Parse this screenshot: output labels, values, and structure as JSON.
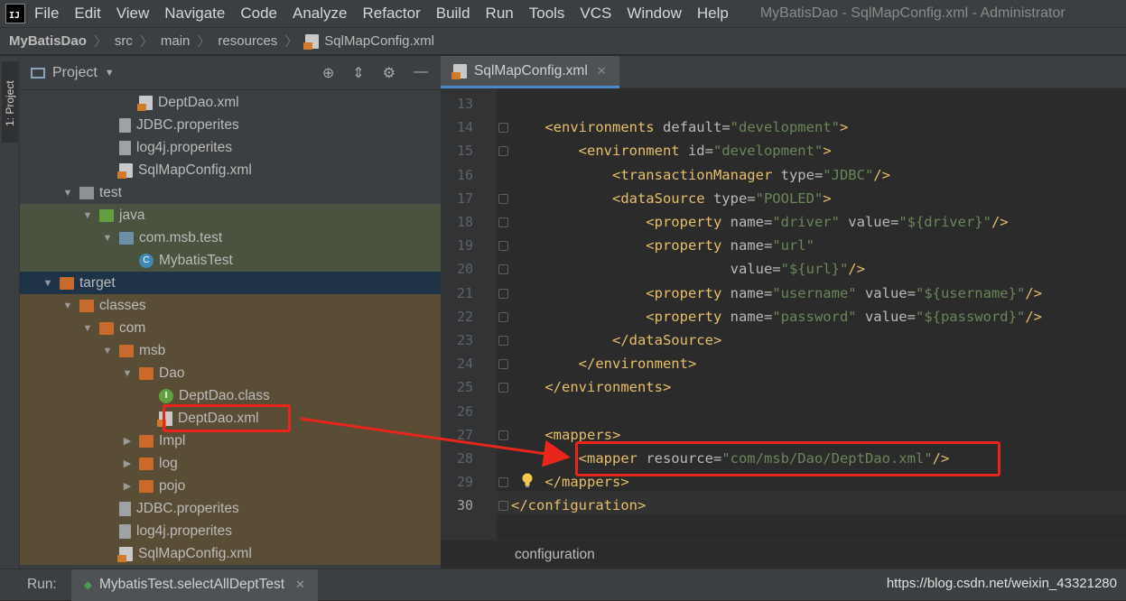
{
  "menubar": {
    "logo": "IJ",
    "items": [
      "File",
      "Edit",
      "View",
      "Navigate",
      "Code",
      "Analyze",
      "Refactor",
      "Build",
      "Run",
      "Tools",
      "VCS",
      "Window",
      "Help"
    ],
    "window_title": "MyBatisDao - SqlMapConfig.xml - Administrator"
  },
  "navbar": {
    "crumbs": [
      "MyBatisDao",
      "src",
      "main",
      "resources",
      "SqlMapConfig.xml"
    ]
  },
  "left_strip": {
    "tab_label": "1: Project"
  },
  "project": {
    "header": "Project",
    "rows": [
      {
        "label": "DeptDao.xml",
        "icon": "xml-file-icon",
        "indent": 4,
        "arrow": "",
        "bg": ""
      },
      {
        "label": "JDBC.properites",
        "icon": "properties-file-icon",
        "indent": 3,
        "arrow": "",
        "bg": ""
      },
      {
        "label": "log4j.properites",
        "icon": "properties-file-icon",
        "indent": 3,
        "arrow": "",
        "bg": ""
      },
      {
        "label": "SqlMapConfig.xml",
        "icon": "xml-file-icon",
        "indent": 3,
        "arrow": "",
        "bg": ""
      },
      {
        "label": "test",
        "icon": "folder-icon",
        "indent": 1,
        "arrow": "down",
        "bg": ""
      },
      {
        "label": "java",
        "icon": "test-source-folder-icon",
        "indent": 2,
        "arrow": "down",
        "bg": "g"
      },
      {
        "label": "com.msb.test",
        "icon": "package-icon",
        "indent": 3,
        "arrow": "down",
        "bg": "g"
      },
      {
        "label": "MybatisTest",
        "icon": "class-icon",
        "indent": 4,
        "arrow": "",
        "bg": "g"
      },
      {
        "label": "target",
        "icon": "excluded-folder-icon",
        "indent": 0,
        "arrow": "down",
        "bg": "b"
      },
      {
        "label": "classes",
        "icon": "excluded-folder-icon",
        "indent": 1,
        "arrow": "down",
        "bg": "o"
      },
      {
        "label": "com",
        "icon": "excluded-folder-icon",
        "indent": 2,
        "arrow": "down",
        "bg": "o"
      },
      {
        "label": "msb",
        "icon": "excluded-folder-icon",
        "indent": 3,
        "arrow": "down",
        "bg": "o"
      },
      {
        "label": "Dao",
        "icon": "excluded-folder-icon",
        "indent": 4,
        "arrow": "down",
        "bg": "o"
      },
      {
        "label": "DeptDao.class",
        "icon": "interface-class-icon",
        "indent": 5,
        "arrow": "",
        "bg": "o"
      },
      {
        "label": "DeptDao.xml",
        "icon": "xml-file-icon",
        "indent": 5,
        "arrow": "",
        "bg": "o"
      },
      {
        "label": "Impl",
        "icon": "excluded-folder-icon",
        "indent": 4,
        "arrow": "right",
        "bg": "o"
      },
      {
        "label": "log",
        "icon": "excluded-folder-icon",
        "indent": 4,
        "arrow": "right",
        "bg": "o"
      },
      {
        "label": "pojo",
        "icon": "excluded-folder-icon",
        "indent": 4,
        "arrow": "right",
        "bg": "o"
      },
      {
        "label": "JDBC.properites",
        "icon": "properties-file-icon",
        "indent": 3,
        "arrow": "",
        "bg": "o"
      },
      {
        "label": "log4j.properites",
        "icon": "properties-file-icon",
        "indent": 3,
        "arrow": "",
        "bg": "o"
      },
      {
        "label": "SqlMapConfig.xml",
        "icon": "xml-file-icon",
        "indent": 3,
        "arrow": "",
        "bg": "o"
      }
    ]
  },
  "editor": {
    "tab": "SqlMapConfig.xml",
    "current_line": 30,
    "lines": [
      {
        "n": 13,
        "tokens": []
      },
      {
        "n": 14,
        "tokens": [
          [
            "tag",
            "    <environments "
          ],
          [
            "att",
            "default"
          ],
          [
            "ep",
            "="
          ],
          [
            "val",
            "\"development\""
          ],
          [
            "tag",
            ">"
          ]
        ]
      },
      {
        "n": 15,
        "tokens": [
          [
            "tag",
            "        <environment "
          ],
          [
            "att",
            "id"
          ],
          [
            "ep",
            "="
          ],
          [
            "val",
            "\"development\""
          ],
          [
            "tag",
            ">"
          ]
        ]
      },
      {
        "n": 16,
        "tokens": [
          [
            "tag",
            "            <transactionManager "
          ],
          [
            "att",
            "type"
          ],
          [
            "ep",
            "="
          ],
          [
            "val",
            "\"JDBC\""
          ],
          [
            "tag",
            "/>"
          ]
        ]
      },
      {
        "n": 17,
        "tokens": [
          [
            "tag",
            "            <dataSource "
          ],
          [
            "att",
            "type"
          ],
          [
            "ep",
            "="
          ],
          [
            "val",
            "\"POOLED\""
          ],
          [
            "tag",
            ">"
          ]
        ]
      },
      {
        "n": 18,
        "tokens": [
          [
            "tag",
            "                <property "
          ],
          [
            "att",
            "name"
          ],
          [
            "ep",
            "="
          ],
          [
            "val",
            "\"driver\""
          ],
          [
            "att",
            " value"
          ],
          [
            "ep",
            "="
          ],
          [
            "val",
            "\"${driver}\""
          ],
          [
            "tag",
            "/>"
          ]
        ]
      },
      {
        "n": 19,
        "tokens": [
          [
            "tag",
            "                <property "
          ],
          [
            "att",
            "name"
          ],
          [
            "ep",
            "="
          ],
          [
            "val",
            "\"url\""
          ]
        ]
      },
      {
        "n": 20,
        "tokens": [
          [
            "att",
            "                          value"
          ],
          [
            "ep",
            "="
          ],
          [
            "val",
            "\"${url}\""
          ],
          [
            "tag",
            "/>"
          ]
        ]
      },
      {
        "n": 21,
        "tokens": [
          [
            "tag",
            "                <property "
          ],
          [
            "att",
            "name"
          ],
          [
            "ep",
            "="
          ],
          [
            "val",
            "\"username\""
          ],
          [
            "att",
            " value"
          ],
          [
            "ep",
            "="
          ],
          [
            "val",
            "\"${username}\""
          ],
          [
            "tag",
            "/>"
          ]
        ]
      },
      {
        "n": 22,
        "tokens": [
          [
            "tag",
            "                <property "
          ],
          [
            "att",
            "name"
          ],
          [
            "ep",
            "="
          ],
          [
            "val",
            "\"password\""
          ],
          [
            "att",
            " value"
          ],
          [
            "ep",
            "="
          ],
          [
            "val",
            "\"${password}\""
          ],
          [
            "tag",
            "/>"
          ]
        ]
      },
      {
        "n": 23,
        "tokens": [
          [
            "tag",
            "            </dataSource>"
          ]
        ]
      },
      {
        "n": 24,
        "tokens": [
          [
            "tag",
            "        </environment>"
          ]
        ]
      },
      {
        "n": 25,
        "tokens": [
          [
            "tag",
            "    </environments>"
          ]
        ]
      },
      {
        "n": 26,
        "tokens": []
      },
      {
        "n": 27,
        "tokens": [
          [
            "tag",
            "    <mappers>"
          ]
        ]
      },
      {
        "n": 28,
        "tokens": [
          [
            "tag",
            "        <mapper "
          ],
          [
            "att",
            "resource"
          ],
          [
            "ep",
            "="
          ],
          [
            "val",
            "\"com/msb/Dao/DeptDao.xml\""
          ],
          [
            "tag",
            "/>"
          ]
        ]
      },
      {
        "n": 29,
        "tokens": [
          [
            "tag",
            "    </mappers>"
          ]
        ]
      },
      {
        "n": 30,
        "tokens": [
          [
            "tag",
            "</configuration>"
          ]
        ]
      }
    ],
    "breadcrumb": "configuration"
  },
  "run": {
    "label": "Run:",
    "tab": "MybatisTest.selectAllDeptTest"
  },
  "watermark": "https://blog.csdn.net/weixin_43321280",
  "colors": {
    "annotation": "#e8261b",
    "tag": "#e8bf6a",
    "value": "#6a8759"
  }
}
